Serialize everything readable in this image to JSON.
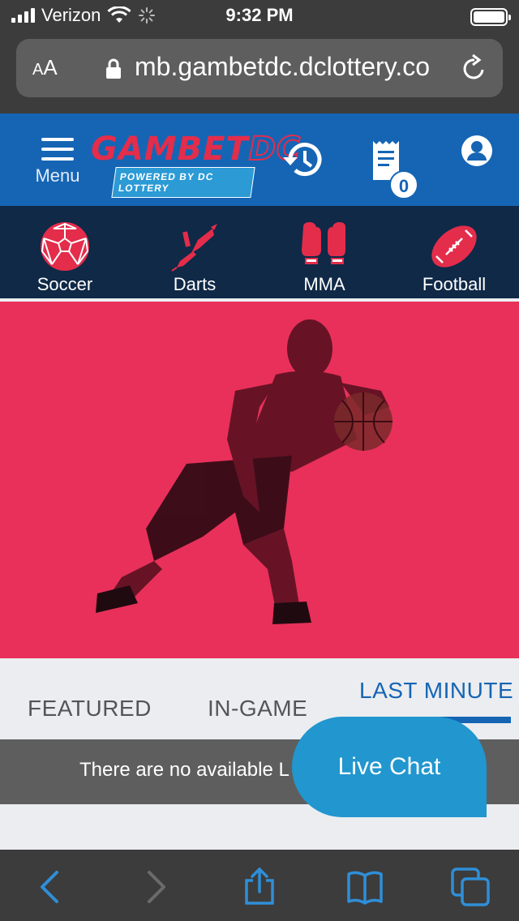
{
  "status_bar": {
    "carrier": "Verizon",
    "time": "9:32 PM"
  },
  "browser": {
    "text_size_label": "AA",
    "url": "mb.gambetdc.dclottery.co"
  },
  "header": {
    "menu_label": "Menu",
    "logo_text_a": "GAMBET",
    "logo_text_b": "DC",
    "logo_tagline": "POWERED BY DC LOTTERY",
    "bet_slip_count": "0"
  },
  "sports_nav": {
    "items": [
      {
        "label": "Soccer",
        "icon": "soccer-ball-icon"
      },
      {
        "label": "Darts",
        "icon": "dart-icon"
      },
      {
        "label": "MMA",
        "icon": "mma-gloves-icon"
      },
      {
        "label": "Football",
        "icon": "football-icon"
      }
    ]
  },
  "hero": {
    "image": "basketball-player-dribbling"
  },
  "tabs": {
    "items": [
      {
        "label": "FEATURED",
        "active": false
      },
      {
        "label": "IN-GAME",
        "active": false
      },
      {
        "label": "LAST MINUTE",
        "active": true
      }
    ]
  },
  "events": {
    "empty_message": "There are no available L"
  },
  "live_chat": {
    "label": "Live Chat"
  },
  "toolbar": {
    "icons": [
      "back-icon",
      "forward-icon",
      "share-icon",
      "bookmarks-icon",
      "tabs-icon"
    ]
  },
  "colors": {
    "brand_blue": "#1565b4",
    "brand_red": "#e32d4b",
    "nav_navy": "#0f2947",
    "hero_pink": "#e8305a",
    "chat_blue": "#2196cf"
  }
}
